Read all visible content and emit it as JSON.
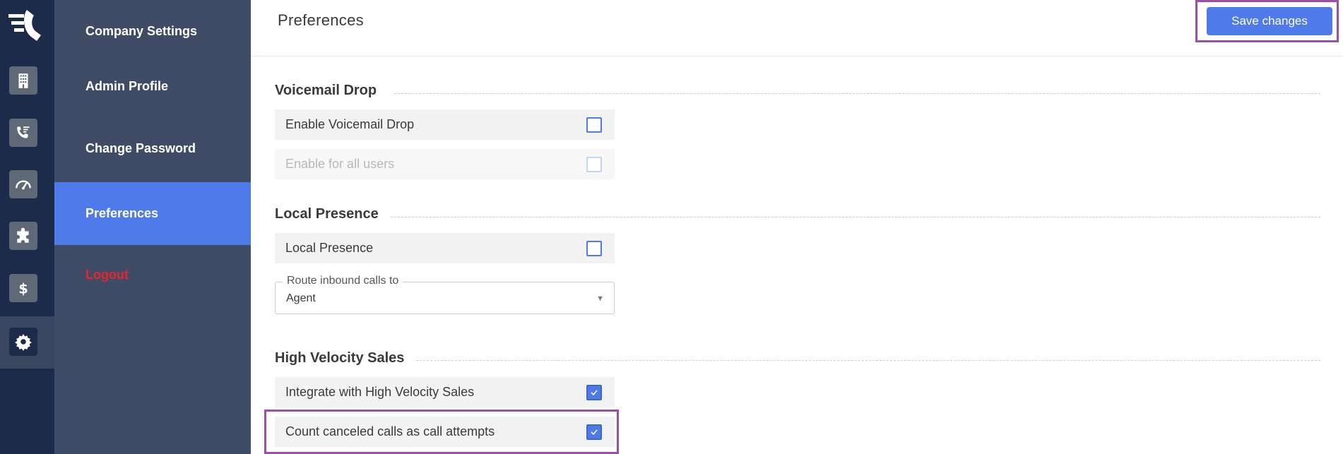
{
  "rail": {
    "items": [
      {
        "name": "building-icon"
      },
      {
        "name": "phone-list-icon"
      },
      {
        "name": "gauge-icon"
      },
      {
        "name": "puzzle-icon"
      },
      {
        "name": "dollar-icon"
      },
      {
        "name": "gear-icon"
      }
    ]
  },
  "nav": {
    "items": [
      {
        "label": "Company Settings"
      },
      {
        "label": "Admin Profile"
      },
      {
        "label": "Change Password"
      },
      {
        "label": "Preferences",
        "active": true
      },
      {
        "label": "Logout"
      }
    ]
  },
  "header": {
    "title": "Preferences",
    "save_label": "Save changes"
  },
  "sections": {
    "voicemail": {
      "title": "Voicemail Drop",
      "rows": [
        {
          "label": "Enable Voicemail Drop",
          "checked": false,
          "disabled": false
        },
        {
          "label": "Enable for all users",
          "checked": false,
          "disabled": true
        }
      ]
    },
    "presence": {
      "title": "Local Presence",
      "rows": [
        {
          "label": "Local Presence",
          "checked": false,
          "disabled": false
        }
      ],
      "route": {
        "legend": "Route inbound calls to",
        "value": "Agent"
      }
    },
    "hvs": {
      "title": "High Velocity Sales",
      "rows": [
        {
          "label": "Integrate with High Velocity Sales",
          "checked": true,
          "disabled": false
        },
        {
          "label": "Count canceled calls as call attempts",
          "checked": true,
          "disabled": false
        }
      ]
    }
  },
  "colors": {
    "accent": "#4f7bea",
    "rail_bg": "#1d2b4a",
    "nav_bg": "#404c66",
    "highlight": "#9b4fa5",
    "logout": "#e8252a"
  }
}
